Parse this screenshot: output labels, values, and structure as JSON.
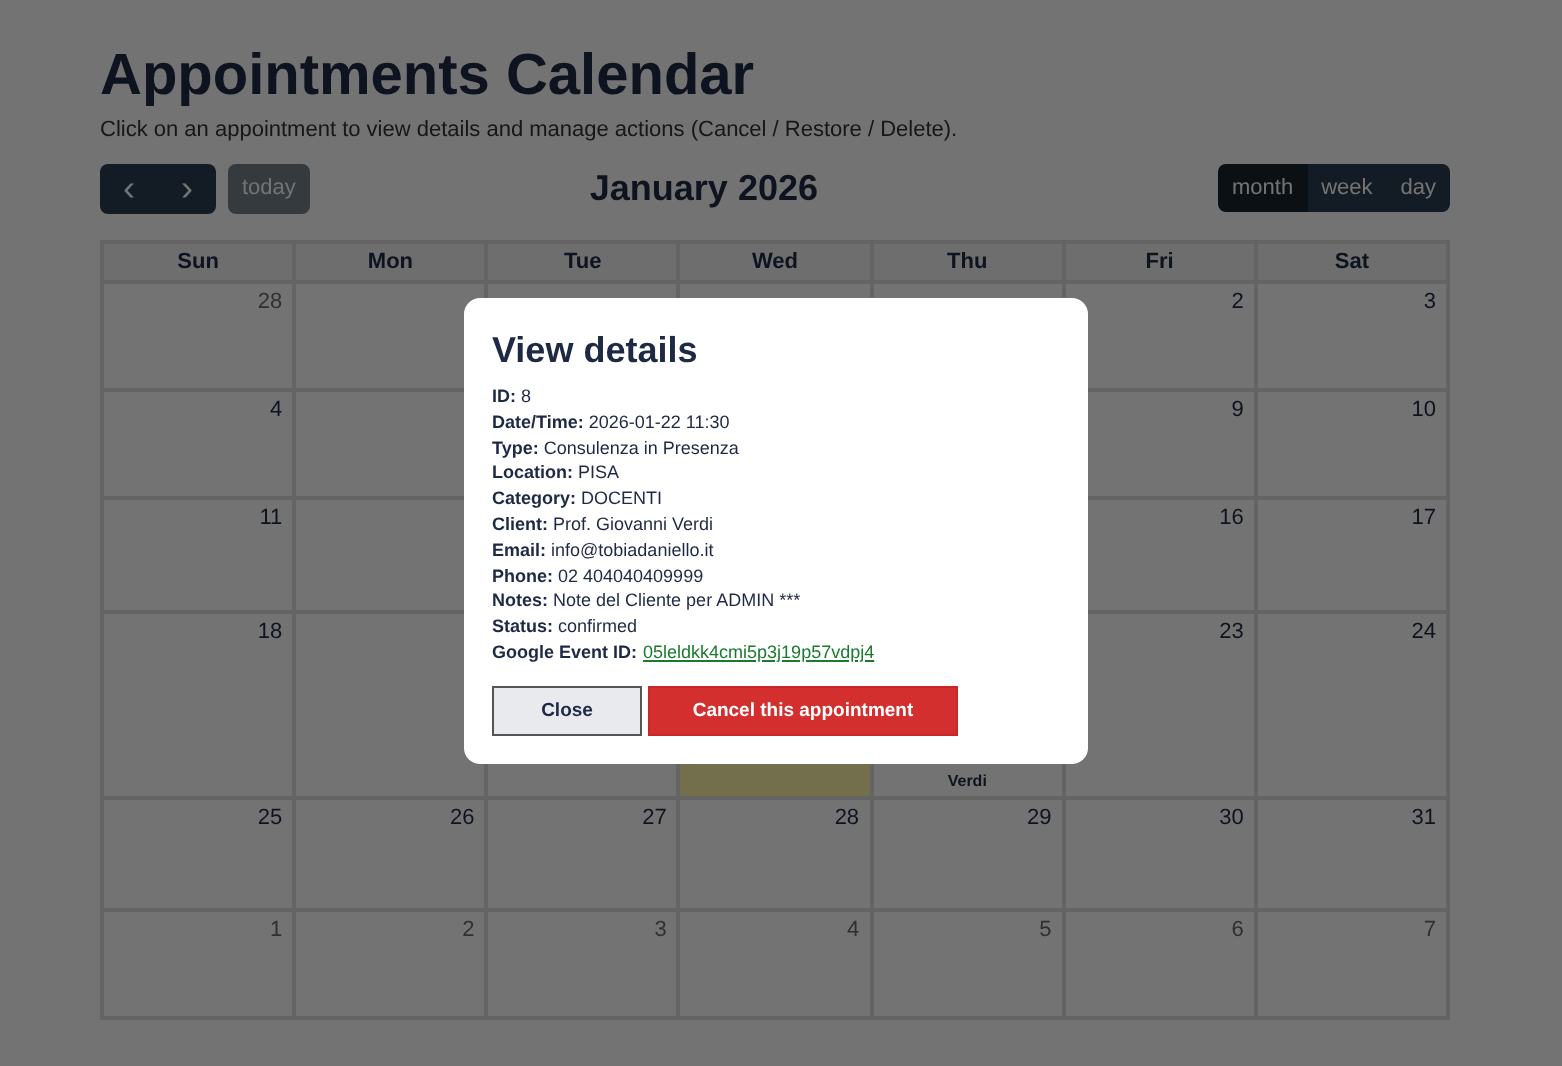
{
  "page": {
    "title": "Appointments Calendar",
    "subtitle": "Click on an appointment to view details and manage actions (Cancel / Restore / Delete)."
  },
  "toolbar": {
    "prev": "‹",
    "next": "›",
    "today": {
      "label": "today",
      "disabled": true
    },
    "period": "January 2026",
    "views": [
      {
        "label": "month",
        "selected": true
      },
      {
        "label": "week",
        "selected": false
      },
      {
        "label": "day",
        "selected": false
      }
    ]
  },
  "calendar": {
    "weekdays": [
      "Sun",
      "Mon",
      "Tue",
      "Wed",
      "Thu",
      "Fri",
      "Sat"
    ],
    "weeks": [
      [
        {
          "day": "28",
          "other_month": true,
          "today": false
        },
        {
          "today": false
        },
        {
          "today": false
        },
        {
          "today": false
        },
        {
          "today": false
        },
        {
          "day": "2",
          "other_month": false,
          "today": false
        },
        {
          "day": "3",
          "other_month": false,
          "today": false
        }
      ],
      {
        "start": [
          {
            "day": "4",
            "other_month": false,
            "today": false
          },
          {
            "today": false
          }
        ],
        "end": [
          {
            "day": "9",
            "other_month": false,
            "today": false
          },
          {
            "day": "10",
            "other_month": false,
            "today": false
          }
        ]
      },
      {
        "start": [
          {
            "day": "11",
            "other_month": false,
            "today": false
          },
          {
            "today": false
          }
        ],
        "end": [
          {
            "day": "16",
            "other_month": false,
            "today": false
          },
          {
            "day": "17",
            "other_month": false,
            "today": false
          }
        ]
      },
      [
        {
          "day": "18",
          "other_month": false,
          "today": false
        },
        {
          "today": false
        },
        {
          "today": false
        },
        {
          "today": true
        },
        {
          "today": false,
          "events": [
            "Verdi"
          ]
        },
        {
          "day": "23",
          "other_month": false
        },
        {
          "day": "24",
          "other_month": false
        }
      ],
      [
        {
          "day": "25",
          "other_month": false
        },
        {
          "day": "26",
          "other_month": false
        },
        {
          "day": "27",
          "other_month": false
        },
        {
          "day": "28",
          "other_month": false
        },
        {
          "day": "29",
          "other_month": false
        },
        {
          "day": "30",
          "other_month": false
        },
        {
          "day": "31",
          "other_month": false
        }
      ],
      [
        {
          "day": "1",
          "other_month": true
        },
        {
          "day": "2",
          "other_month": true
        },
        {
          "day": "3",
          "other_month": true
        },
        {
          "day": "4",
          "other_month": true
        },
        {
          "day": "5",
          "other_month": true
        },
        {
          "day": "6",
          "other_month": true
        },
        {
          "day": "7",
          "other_month": true
        }
      ]
    ]
  },
  "modal": {
    "title": "View details",
    "fields": [
      {
        "kind": "text",
        "label": "ID:",
        "value": "8"
      },
      {
        "kind": "text",
        "label": "Date/Time:",
        "value": "2026-01-22 11:30"
      },
      {
        "kind": "text",
        "label": "Type:",
        "value": "Consulenza in Presenza"
      },
      {
        "kind": "text",
        "label": "Location:",
        "value": "PISA"
      },
      {
        "kind": "text",
        "label": "Category:",
        "value": "DOCENTI"
      },
      {
        "kind": "text",
        "label": "Client:",
        "value": "Prof. Giovanni Verdi"
      },
      {
        "kind": "text",
        "label": "Email:",
        "value": "info@tobiadaniello.it"
      },
      {
        "kind": "text",
        "label": "Phone:",
        "value": "02 404040409999"
      },
      {
        "kind": "text",
        "label": "Notes:",
        "value": "Note del Cliente per ADMIN ***"
      },
      {
        "kind": "text",
        "label": "Status:",
        "value": "confirmed"
      },
      {
        "kind": "link",
        "label": "Google Event ID:",
        "value": "05leldkk4cmi5p3j19p57vdpj4"
      }
    ],
    "buttons": [
      {
        "kind": "secondary",
        "label": "Close"
      },
      {
        "kind": "danger",
        "label": "Cancel this appointment"
      }
    ]
  }
}
